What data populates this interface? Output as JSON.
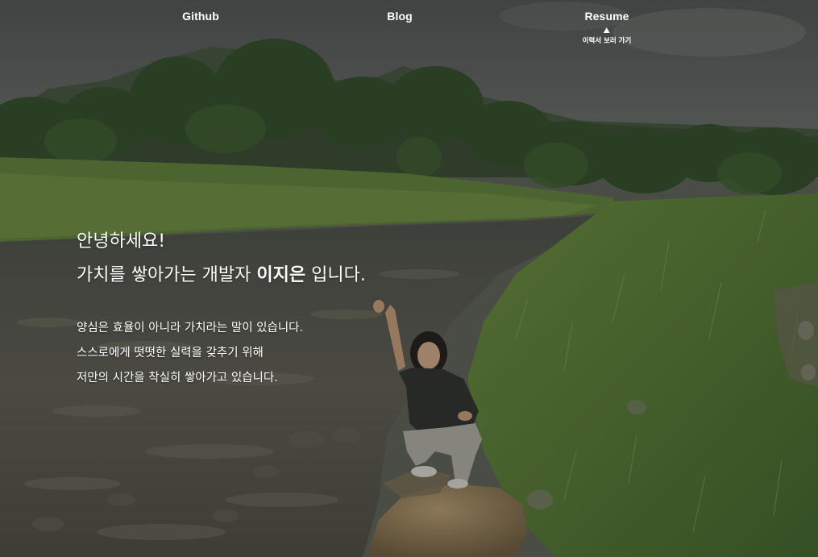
{
  "nav": {
    "github_label": "Github",
    "blog_label": "Blog",
    "resume_label": "Resume",
    "resume_tooltip": "이력서 보러 가기"
  },
  "intro": {
    "greeting": "안녕하세요!",
    "headline_prefix": "가치를 쌓아가는 개발자 ",
    "name": "이지은",
    "headline_suffix": " 입니다.",
    "description": [
      "양심은 효율이 아니라 가치라는 말이 있습니다.",
      "스스로에게 떳떳한 실력을 갖추기 위해",
      "저만의 시간을 착실히 쌓아가고 있습니다."
    ]
  },
  "colors": {
    "text": "#ffffff",
    "overlay": "#1e201e"
  }
}
